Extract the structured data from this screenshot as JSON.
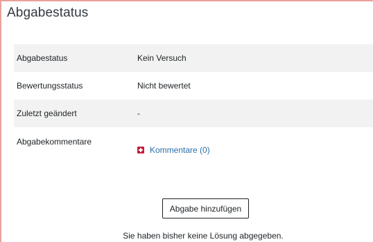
{
  "section": {
    "title": "Abgabestatus"
  },
  "status_table": {
    "rows": [
      {
        "label": "Abgabestatus",
        "value": "Kein Versuch"
      },
      {
        "label": "Bewertungsstatus",
        "value": "Nicht bewertet"
      },
      {
        "label": "Zuletzt geändert",
        "value": "-"
      },
      {
        "label": "Abgabekommentare",
        "value": "Kommentare (0)"
      }
    ]
  },
  "actions": {
    "add_submission_label": "Abgabe hinzufügen",
    "note": "Sie haben bisher keine Lösung abgegeben."
  },
  "colors": {
    "accent_border": "#e8a19a",
    "link": "#2a6ea8",
    "plus_icon": "#c51c3c",
    "row_shade": "#f2f2f2"
  }
}
